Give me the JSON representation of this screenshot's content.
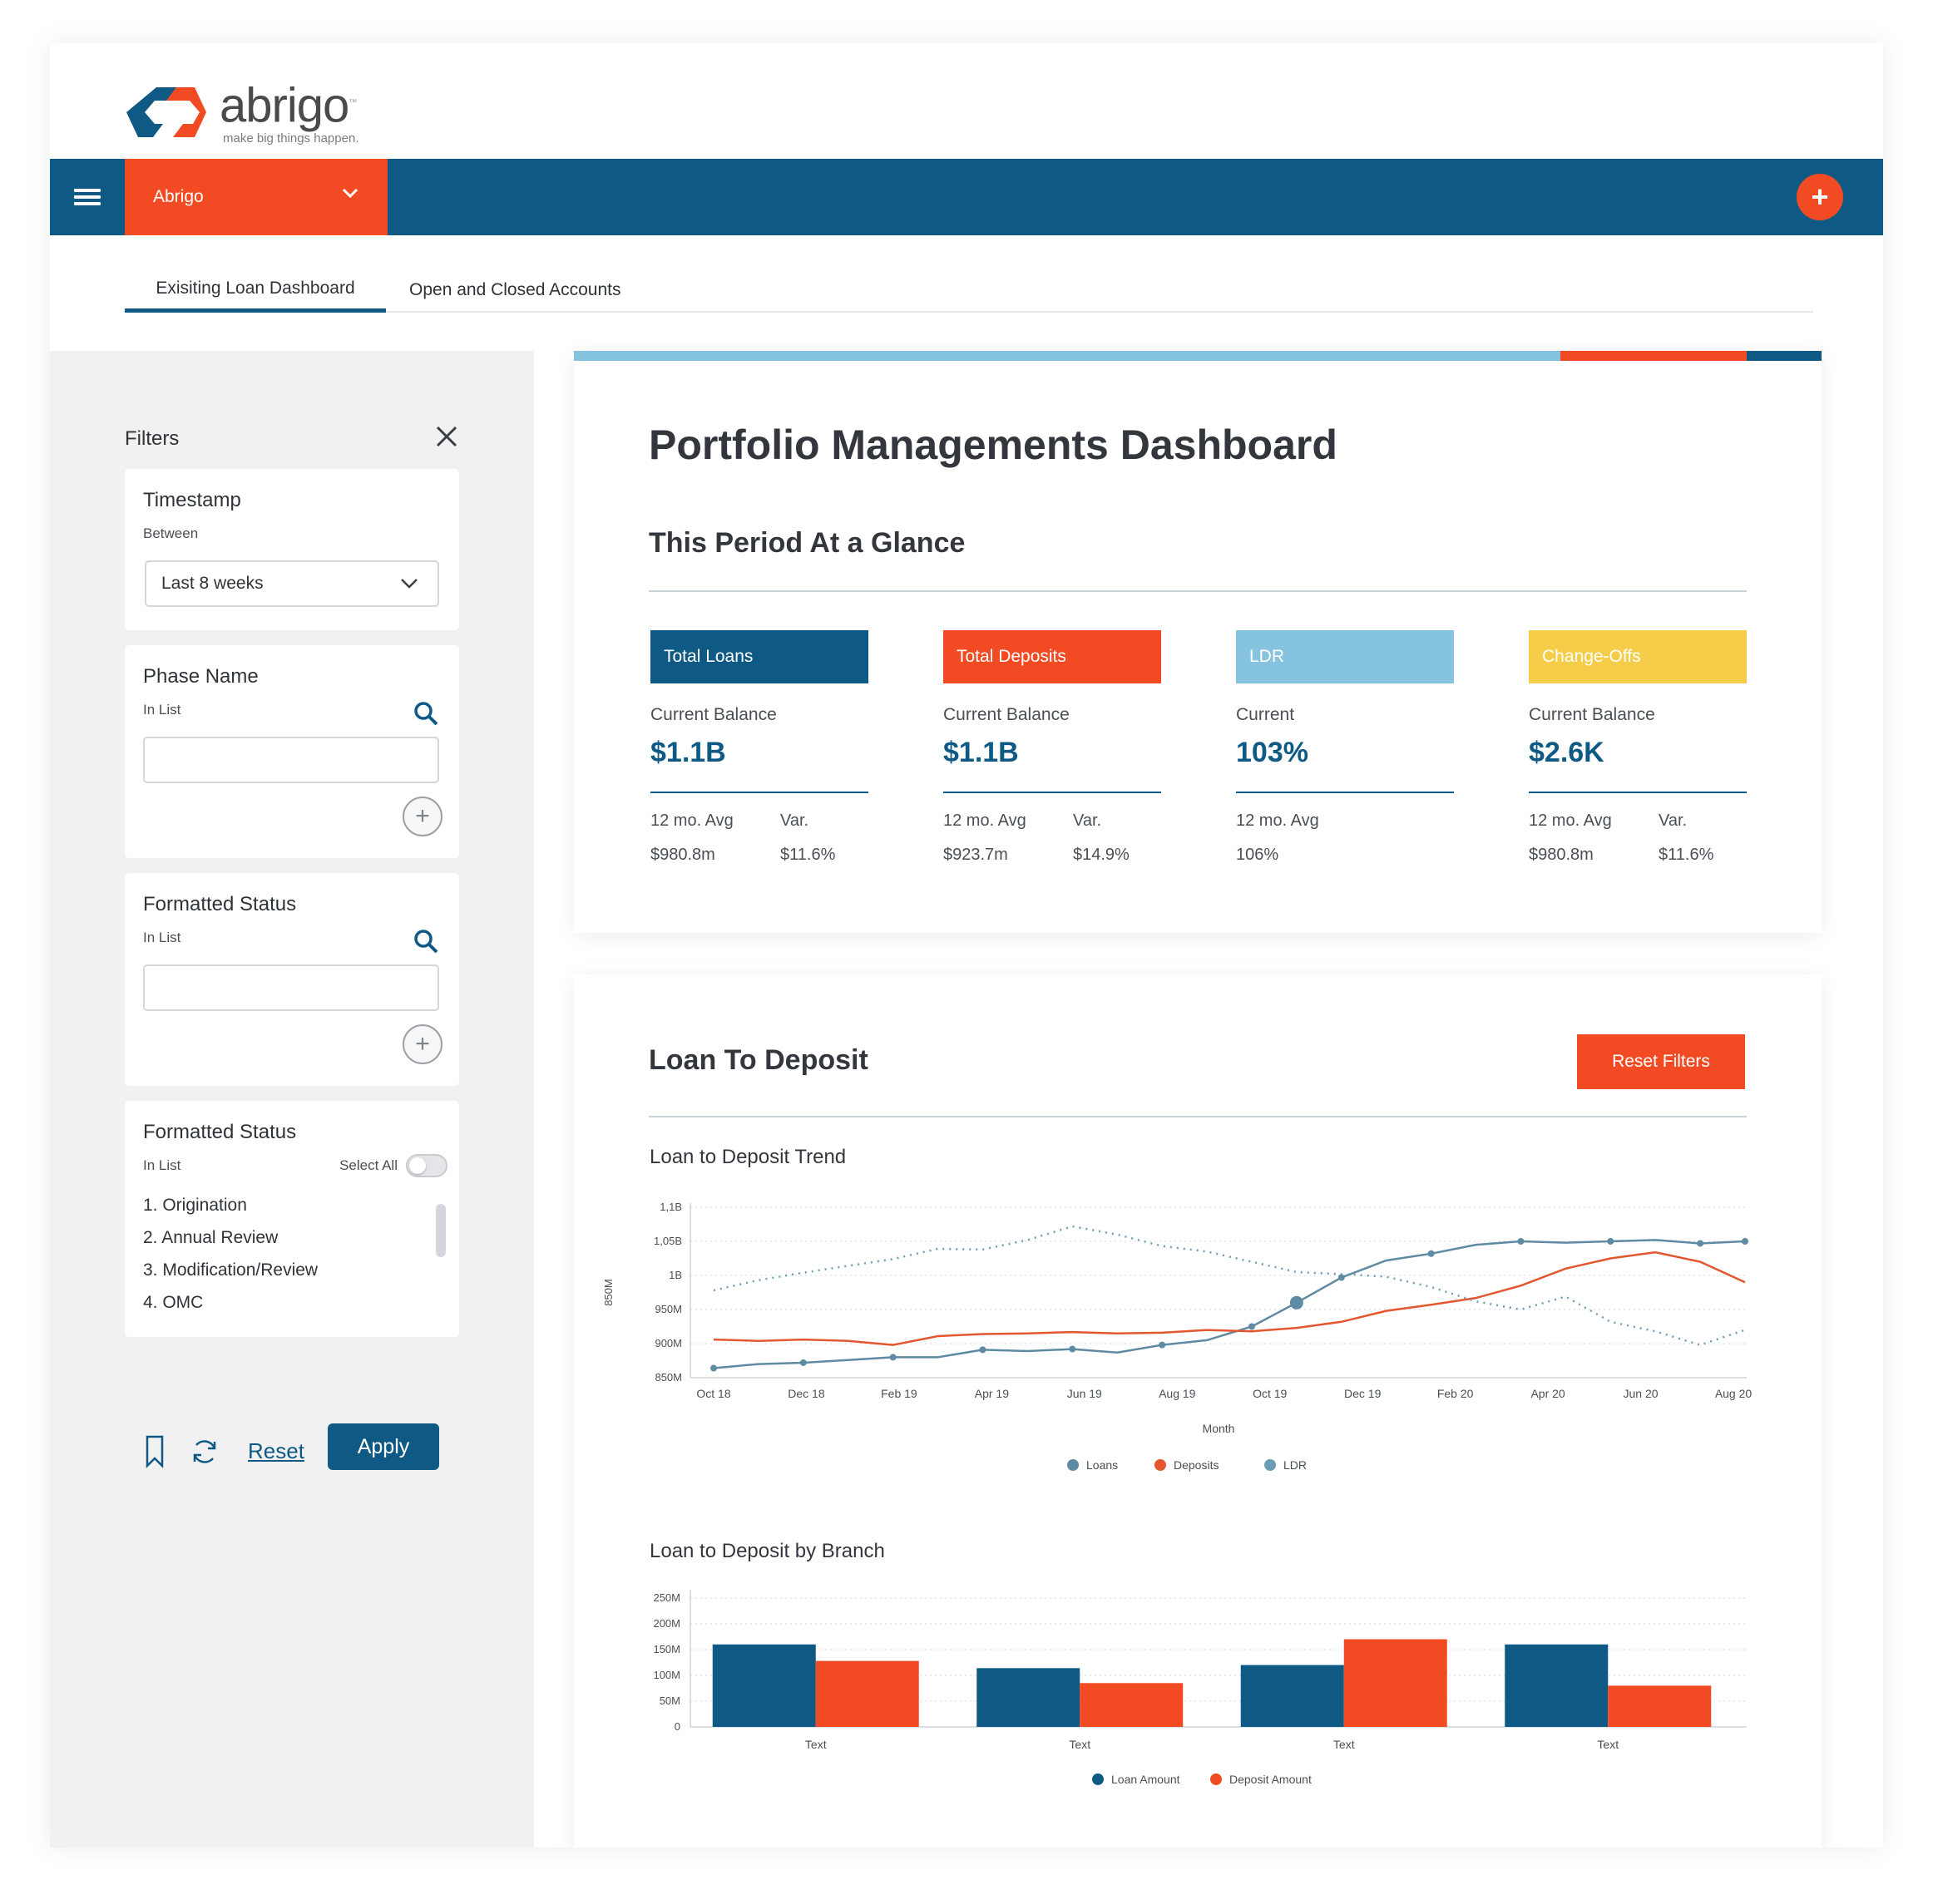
{
  "brand": {
    "name": "abrigo",
    "tagline": "make big things happen.",
    "tm": "™"
  },
  "topbar": {
    "org": "Abrigo",
    "add_label": "+"
  },
  "tabs": [
    {
      "label": "Exisiting Loan Dashboard"
    },
    {
      "label": "Open and Closed Accounts"
    }
  ],
  "filters": {
    "title": "Filters",
    "timestamp": {
      "title": "Timestamp",
      "sub": "Between",
      "value": "Last 8 weeks"
    },
    "phase": {
      "title": "Phase Name",
      "sub": "In List",
      "input": ""
    },
    "status1": {
      "title": "Formatted Status",
      "sub": "In List",
      "input": ""
    },
    "status2": {
      "title": "Formatted Status",
      "sub": "In List",
      "select_all": "Select All",
      "items": [
        "1. Origination",
        "2. Annual Review",
        "3. Modification/Review",
        "4. OMC"
      ]
    },
    "reset": "Reset",
    "apply": "Apply"
  },
  "dashboard": {
    "title": "Portfolio Managements Dashboard",
    "glance_title": "This Period At a Glance",
    "accent_colors": [
      "#86c3df",
      "#f24b24",
      "#0f5a85"
    ],
    "kpis": [
      {
        "header": "Total Loans",
        "color": "#0f5a85",
        "label": "Current Balance",
        "value": "$1.1B",
        "avg_label": "12 mo. Avg",
        "var_label": "Var.",
        "avg": "$980.8m",
        "var": "$11.6%"
      },
      {
        "header": "Total Deposits",
        "color": "#f24b24",
        "label": "Current Balance",
        "value": "$1.1B",
        "avg_label": "12 mo. Avg",
        "var_label": "Var.",
        "avg": "$923.7m",
        "var": "$14.9%"
      },
      {
        "header": "LDR",
        "color": "#86c3df",
        "label": "Current",
        "value": "103%",
        "avg_label": "12 mo. Avg",
        "var_label": "",
        "avg": "106%",
        "var": ""
      },
      {
        "header": "Change-Offs",
        "color": "#f5cd48",
        "label": "Current Balance",
        "value": "$2.6K",
        "avg_label": "12 mo. Avg",
        "var_label": "Var.",
        "avg": "$980.8m",
        "var": "$11.6%"
      }
    ]
  },
  "ltd": {
    "title": "Loan To Deposit",
    "reset_filters": "Reset Filters",
    "trend_title": "Loan to Deposit Trend",
    "branch_title": "Loan to Deposit by Branch"
  },
  "chart_data": [
    {
      "type": "line",
      "title": "Loan to Deposit Trend",
      "xlabel": "Month",
      "ylabel": "850M",
      "y_tick_labels": [
        "850M",
        "900M",
        "950M",
        "1B",
        "1,05B",
        "1,1B"
      ],
      "y_ticks": [
        850,
        900,
        950,
        1000,
        1050,
        1100
      ],
      "ylim": [
        850,
        1100
      ],
      "x_tick_labels": [
        "Oct 18",
        "Dec 18",
        "Feb 19",
        "Apr 19",
        "Jun 19",
        "Aug 19",
        "Oct 19",
        "Dec 19",
        "Feb 20",
        "Apr 20",
        "Jun 20",
        "Aug 20"
      ],
      "grid": true,
      "legend_position": "bottom",
      "series": [
        {
          "name": "Loans",
          "color": "#5e8aa3",
          "style": "solid-markers",
          "values": [
            864,
            870,
            872,
            876,
            880,
            880,
            891,
            889,
            892,
            887,
            898,
            905,
            925,
            960,
            997,
            1022,
            1032,
            1045,
            1050,
            1048,
            1050,
            1052,
            1047,
            1050
          ]
        },
        {
          "name": "Deposits",
          "color": "#e4562f",
          "style": "solid",
          "values": [
            906,
            904,
            906,
            904,
            898,
            911,
            914,
            915,
            917,
            915,
            916,
            920,
            918,
            923,
            932,
            948,
            957,
            967,
            985,
            1010,
            1025,
            1034,
            1020,
            990
          ]
        },
        {
          "name": "LDR",
          "color": "#6c9db5",
          "style": "dotted",
          "values": [
            978,
            993,
            1004,
            1014,
            1024,
            1039,
            1038,
            1052,
            1072,
            1060,
            1043,
            1035,
            1020,
            1005,
            1002,
            998,
            983,
            962,
            950,
            969,
            932,
            918,
            898,
            920
          ]
        }
      ],
      "highlight_point": {
        "series": "Loans",
        "index": 13
      }
    },
    {
      "type": "bar",
      "title": "Loan to Deposit by Branch",
      "categories": [
        "Text",
        "Text",
        "Text",
        "Text"
      ],
      "y_tick_labels": [
        "0",
        "50M",
        "100M",
        "150M",
        "200M",
        "250M"
      ],
      "y_ticks": [
        0,
        50,
        100,
        150,
        200,
        250
      ],
      "ylim": [
        0,
        250
      ],
      "grid": true,
      "legend_position": "bottom",
      "series": [
        {
          "name": "Loan Amount",
          "color": "#0f5a85",
          "values": [
            160,
            114,
            120,
            160
          ]
        },
        {
          "name": "Deposit Amount",
          "color": "#f24b24",
          "values": [
            128,
            85,
            170,
            80
          ]
        }
      ]
    }
  ]
}
